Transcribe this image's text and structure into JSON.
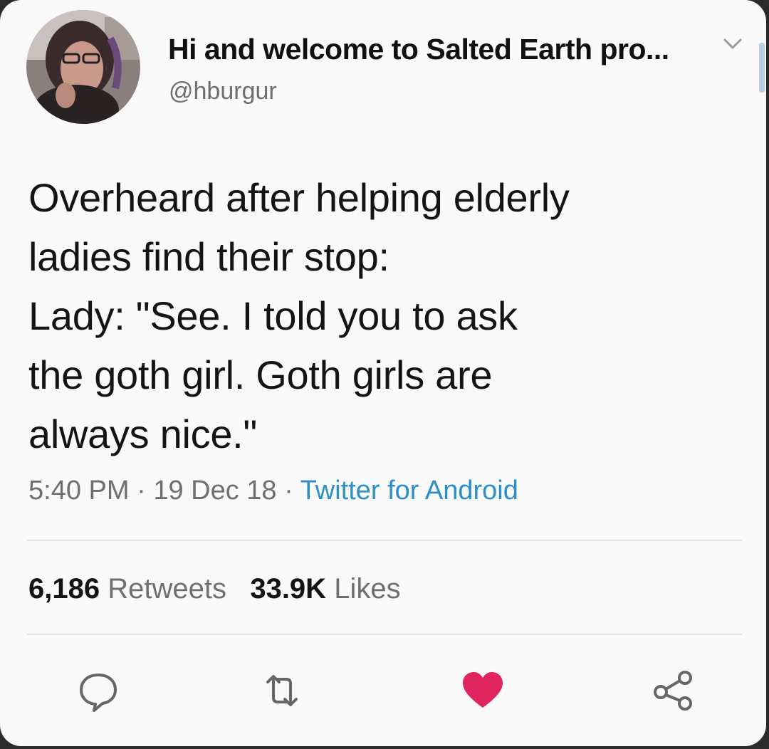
{
  "user": {
    "display_name": "Hi and welcome to Salted Earth pro...",
    "handle": "@hburgur"
  },
  "tweet": {
    "lines": [
      "Overheard after helping elderly",
      "ladies find their stop:",
      "Lady: \"See. I told you to ask",
      "the goth girl. Goth girls are",
      "always nice.\""
    ]
  },
  "meta": {
    "time": "5:40 PM",
    "separator": " · ",
    "date": "19 Dec 18",
    "source": "Twitter for Android"
  },
  "stats": {
    "retweets_count": "6,186",
    "retweets_label": "Retweets",
    "likes_count": "33.9K",
    "likes_label": "Likes"
  },
  "actions": {
    "reply_icon": "speech-bubble-icon",
    "retweet_icon": "retweet-arrows-icon",
    "like_icon": "heart-icon",
    "share_icon": "share-nodes-icon"
  },
  "colors": {
    "link": "#2d8fc7",
    "like_red": "#e0245e",
    "background": "#f9f9f9"
  }
}
